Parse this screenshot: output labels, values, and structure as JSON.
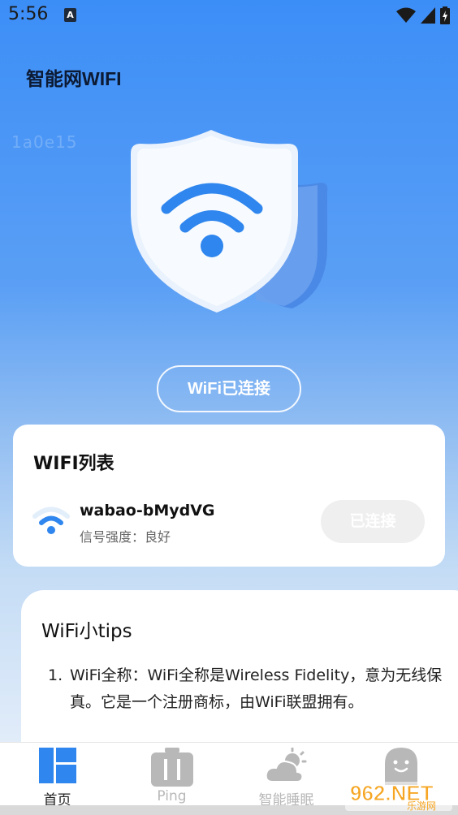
{
  "status_bar": {
    "time": "5:56",
    "notification_letter": "A"
  },
  "app": {
    "title": "智能网WIFI",
    "device_id": "1a0e15"
  },
  "hero": {
    "status_label": "WiFi已连接"
  },
  "wifi_list": {
    "title": "WIFI列表",
    "networks": [
      {
        "ssid": "wabao-bMydVG",
        "strength": "信号强度：良好",
        "action_label": "已连接"
      }
    ]
  },
  "tips": {
    "title": "WiFi小tips",
    "items": [
      {
        "number": "1.",
        "text": "WiFi全称：WiFi全称是Wireless Fidelity，意为无线保真。它是一个注册商标，由WiFi联盟拥有。"
      }
    ]
  },
  "tabs": [
    {
      "label": "首页",
      "icon": "home-grid-icon",
      "active": true
    },
    {
      "label": "Ping",
      "icon": "toolbox-icon",
      "active": false
    },
    {
      "label": "智能睡眠",
      "icon": "cloud-sun-icon",
      "active": false
    },
    {
      "label": "",
      "icon": "ghost-icon",
      "active": false
    }
  ],
  "watermark": {
    "text": "962.NET",
    "subtext": "乐游网"
  },
  "colors": {
    "accent": "#3c8ef7",
    "icon_blue": "#2f86ee",
    "connected_button_bg": "#efefef"
  }
}
